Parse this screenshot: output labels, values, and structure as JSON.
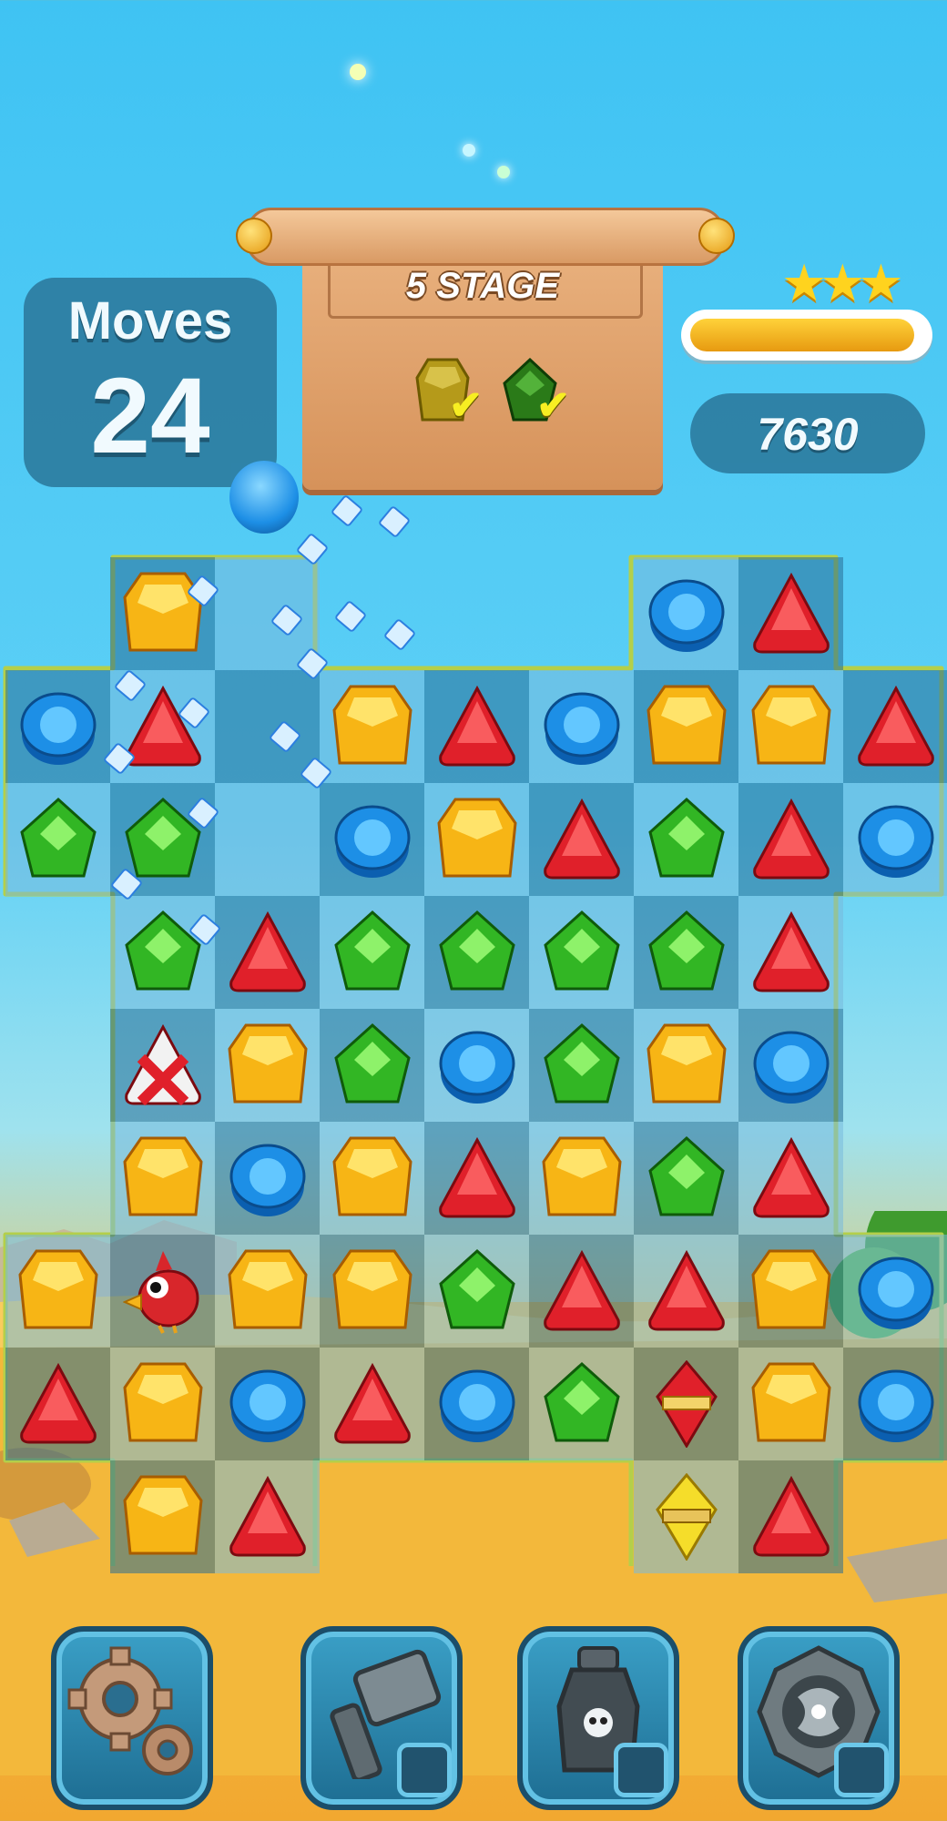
{
  "hud": {
    "moves_label": "Moves",
    "moves_value": "24",
    "stage_title": "5 STAGE",
    "score": "7630",
    "stars_earned": 3,
    "score_progress": 0.96
  },
  "goals": [
    {
      "gem": "yellow-gem-goal-icon",
      "color": "#c8b12a",
      "completed": true
    },
    {
      "gem": "green-gem-goal-icon",
      "color": "#2f8a1e",
      "completed": true
    }
  ],
  "board": {
    "rows": [
      [
        "",
        "yellow",
        "",
        "",
        "",
        "",
        "blue",
        "red",
        ""
      ],
      [
        "blue",
        "red",
        "",
        "yellow",
        "red",
        "blue",
        "yellow",
        "yellow",
        "red"
      ],
      [
        "green",
        "green",
        "",
        "blue",
        "yellow",
        "red",
        "green",
        "red",
        "blue"
      ],
      [
        "",
        "green",
        "red",
        "green",
        "green",
        "green",
        "green",
        "red",
        ""
      ],
      [
        "",
        "striped-red",
        "yellow",
        "green",
        "blue",
        "green",
        "yellow",
        "blue",
        ""
      ],
      [
        "",
        "yellow",
        "blue",
        "yellow",
        "red",
        "yellow",
        "green",
        "red",
        ""
      ],
      [
        "yellow",
        "bird",
        "yellow",
        "yellow",
        "green",
        "red",
        "red",
        "yellow",
        "blue"
      ],
      [
        "red",
        "yellow",
        "blue",
        "red",
        "blue",
        "green",
        "special-red",
        "yellow",
        "blue"
      ],
      [
        "",
        "yellow",
        "red",
        "",
        "",
        "",
        "special-yellow",
        "red",
        ""
      ]
    ]
  },
  "tools": [
    {
      "name": "settings-gear-icon"
    },
    {
      "name": "hammer-booster-icon"
    },
    {
      "name": "potion-booster-icon"
    },
    {
      "name": "shield-booster-icon"
    }
  ],
  "colors": {
    "red": "#e0202a",
    "blue": "#1d8fe6",
    "green": "#32b624",
    "yellow": "#f7b515",
    "board_border": "#b4cf4a"
  }
}
